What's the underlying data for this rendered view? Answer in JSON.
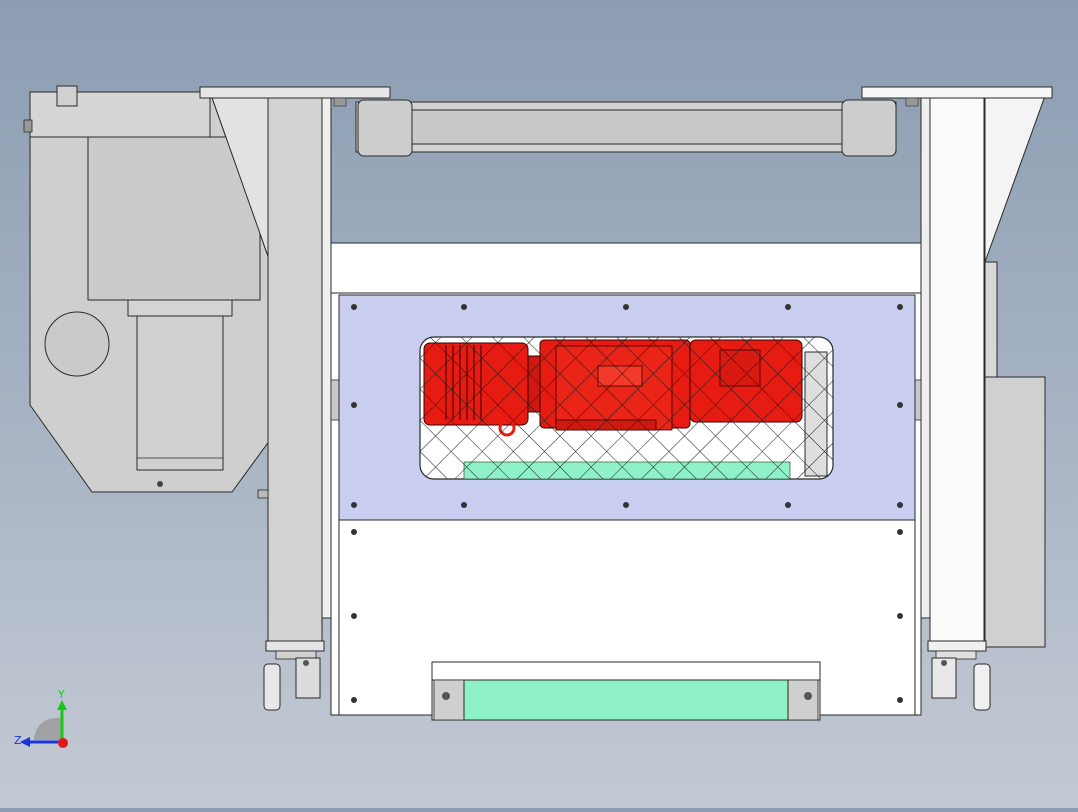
{
  "viewport": {
    "background_top": "#8c9db2",
    "background_bottom": "#c4cad4"
  },
  "colors": {
    "frame_white": "#ffffff",
    "frame_gray": "#d2d2d2",
    "frame_dark": "#b4b4b4",
    "window_panel": "#c9cdf0",
    "motor_red": "#e61c12",
    "accent_green": "#8ef2c6",
    "outline": "#2a2a2a"
  },
  "triad": {
    "x_label": "",
    "y_label": "Y",
    "z_label": "Z",
    "y_color": "#18c818",
    "z_color": "#1a35e0",
    "x_color": "#e01818"
  }
}
